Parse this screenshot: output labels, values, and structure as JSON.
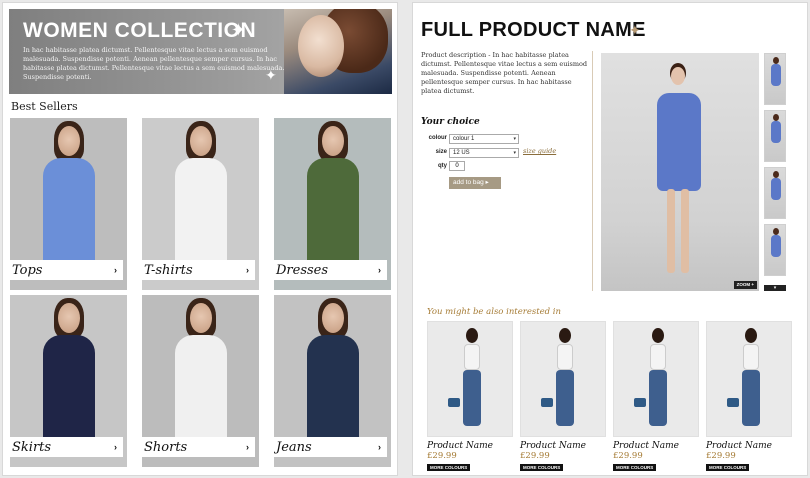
{
  "left": {
    "banner": {
      "title": "WOMEN COLLECTION",
      "text": "In hac habitasse platea dictumst. Pellentesque vitae lectus a sem euismod malesuada. Suspendisse potenti. Aenean pellentesque semper cursus. In hac habitasse platea dictumst. Pellentesque vitae lectus a sem euismod malesuada. Suspendisse potenti."
    },
    "section_title": "Best Sellers",
    "categories": [
      {
        "label": "Tops",
        "bg": "#bdbdbd",
        "body": "#6b8fd8"
      },
      {
        "label": "T-shirts",
        "bg": "#cbcbcb",
        "body": "#f2f2f2"
      },
      {
        "label": "Dresses",
        "bg": "#b4bcbc",
        "body": "#4e6a3a"
      },
      {
        "label": "Skirts",
        "bg": "#c6c6c6",
        "body": "#1f2547"
      },
      {
        "label": "Shorts",
        "bg": "#bcbcbc",
        "body": "#f0f0f0"
      },
      {
        "label": "Jeans",
        "bg": "#c2c2c2",
        "body": "#23324f"
      }
    ],
    "arrow": "›"
  },
  "right": {
    "title": "FULL PRODUCT NAME",
    "description": "Product description - In hac habitasse platea dictumst. Pellentesque vitae lectus a sem euismod malesuada. Suspendisse potenti. Aenean pellentesque semper cursus. In hac habitasse platea dictumst.",
    "choice_title": "Your choice",
    "options": {
      "colour_label": "colour",
      "colour_value": "colour 1",
      "size_label": "size",
      "size_value": "12 US",
      "size_guide": "size guide",
      "qty_label": "qty",
      "qty_value": "0",
      "add_to_bag": "add to bag ▸"
    },
    "zoom_label": "ZOOM +",
    "related_title": "You might be also interested in",
    "related": [
      {
        "name": "Product Name",
        "price": "£29.99",
        "more": "MORE COLOURS"
      },
      {
        "name": "Product Name",
        "price": "£29.99",
        "more": "MORE COLOURS"
      },
      {
        "name": "Product Name",
        "price": "£29.99",
        "more": "MORE COLOURS"
      },
      {
        "name": "Product Name",
        "price": "£29.99",
        "more": "MORE COLOURS"
      }
    ],
    "colors": {
      "accent": "#a67c36",
      "button": "#a69a84",
      "dress": "#5b78c8"
    }
  }
}
